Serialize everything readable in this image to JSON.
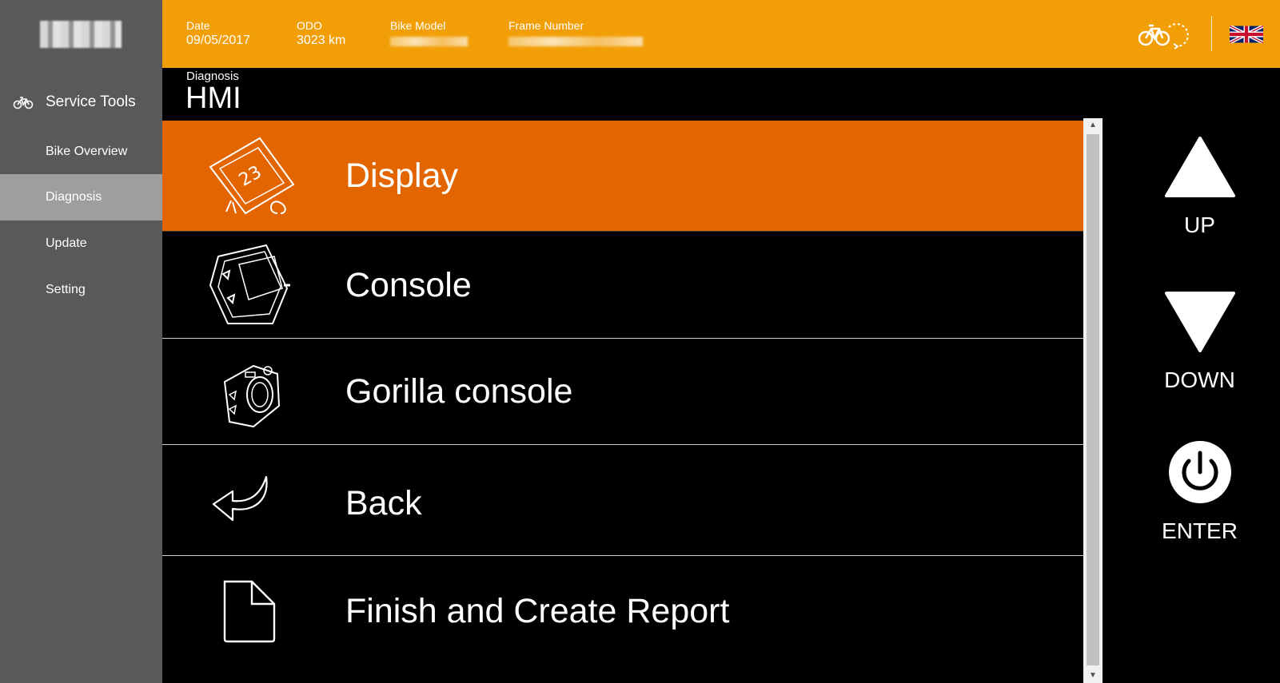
{
  "header": {
    "date_label": "Date",
    "date_value": "09/05/2017",
    "odo_label": "ODO",
    "odo_value": "3023 km",
    "bike_model_label": "Bike Model",
    "frame_number_label": "Frame Number"
  },
  "sidebar": {
    "section_title": "Service Tools",
    "items": [
      {
        "label": "Bike Overview",
        "active": false
      },
      {
        "label": "Diagnosis",
        "active": true
      },
      {
        "label": "Update",
        "active": false
      },
      {
        "label": "Setting",
        "active": false
      }
    ]
  },
  "page": {
    "breadcrumb": "Diagnosis",
    "title": "HMI"
  },
  "menu": {
    "items": [
      {
        "label": "Display",
        "icon": "display-device-icon",
        "selected": true
      },
      {
        "label": "Console",
        "icon": "console-device-icon",
        "selected": false
      },
      {
        "label": "Gorilla console",
        "icon": "gorilla-console-icon",
        "selected": false
      },
      {
        "label": "Back",
        "icon": "back-arrow-icon",
        "selected": false
      },
      {
        "label": "Finish and Create Report",
        "icon": "document-icon",
        "selected": false
      }
    ]
  },
  "controls": {
    "up_label": "UP",
    "down_label": "DOWN",
    "enter_label": "ENTER"
  },
  "colors": {
    "header_bg": "#f29e06",
    "sidebar_bg": "#58595b",
    "sidebar_active_bg": "#9d9e9f",
    "selected_row_bg": "#e36500",
    "main_bg": "#000000"
  }
}
